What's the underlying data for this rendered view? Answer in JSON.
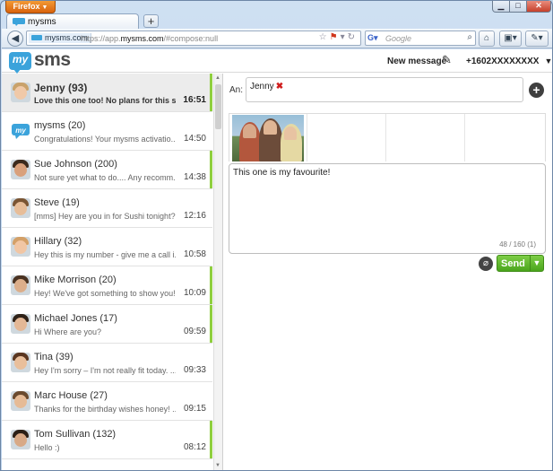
{
  "browser": {
    "menu_button": "Firefox",
    "tab_title": "mysms",
    "new_tab": "+",
    "site_identity": "mysms.com",
    "url_prefix": "https://app.",
    "url_domain": "mysms.com",
    "url_path": "/#compose:null",
    "search_engine": "Google",
    "search_placeholder": "Google"
  },
  "app": {
    "logo_my": "my",
    "logo_sms": "sms",
    "new_message_label": "New message",
    "account_number": "+1602XXXXXXXX"
  },
  "conversations": [
    {
      "name": "Jenny (93)",
      "preview": "Love this one too! No plans for this s...",
      "time": "16:51",
      "selected": true,
      "unread": true,
      "avatar": "avatar-jenny"
    },
    {
      "name": "mysms (20)",
      "preview": "Congratulations! Your mysms activatio...",
      "time": "14:50",
      "selected": false,
      "unread": false,
      "avatar": "mysms-logo-icon"
    },
    {
      "name": "Sue Johnson (200)",
      "preview": "Not sure yet what to do.... Any recomm...",
      "time": "14:38",
      "selected": false,
      "unread": true,
      "avatar": "avatar-sue"
    },
    {
      "name": "Steve (19)",
      "preview": "[mms] Hey are you in for Sushi tonight?",
      "time": "12:16",
      "selected": false,
      "unread": false,
      "avatar": "avatar-steve"
    },
    {
      "name": "Hillary (32)",
      "preview": "Hey this is my number - give me a call i...",
      "time": "10:58",
      "selected": false,
      "unread": false,
      "avatar": "avatar-hillary"
    },
    {
      "name": "Mike Morrison (20)",
      "preview": "Hey! We've got something to show you!",
      "time": "10:09",
      "selected": false,
      "unread": true,
      "avatar": "avatar-mike"
    },
    {
      "name": "Michael Jones (17)",
      "preview": "Hi Where are you?",
      "time": "09:59",
      "selected": false,
      "unread": true,
      "avatar": "avatar-michael"
    },
    {
      "name": "Tina (39)",
      "preview": "Hey I'm sorry – I'm not really fit today. ...",
      "time": "09:33",
      "selected": false,
      "unread": false,
      "avatar": "avatar-tina"
    },
    {
      "name": "Marc House (27)",
      "preview": "Thanks for the birthday wishes honey! ...",
      "time": "09:15",
      "selected": false,
      "unread": false,
      "avatar": "avatar-marc"
    },
    {
      "name": "Tom Sullivan (132)",
      "preview": "Hello :)",
      "time": "08:12",
      "selected": false,
      "unread": true,
      "avatar": "avatar-tom"
    }
  ],
  "compose": {
    "to_label": "An:",
    "recipient": "Jenny",
    "message_text": "This one is my favourite!",
    "char_count": "48 / 160 (1)",
    "send_label": "Send"
  },
  "colors": {
    "accent_green": "#7dcd46",
    "unread_bar": "#8fcf3f",
    "logo_blue": "#3ba3db",
    "remove_red": "#d01d1d"
  }
}
